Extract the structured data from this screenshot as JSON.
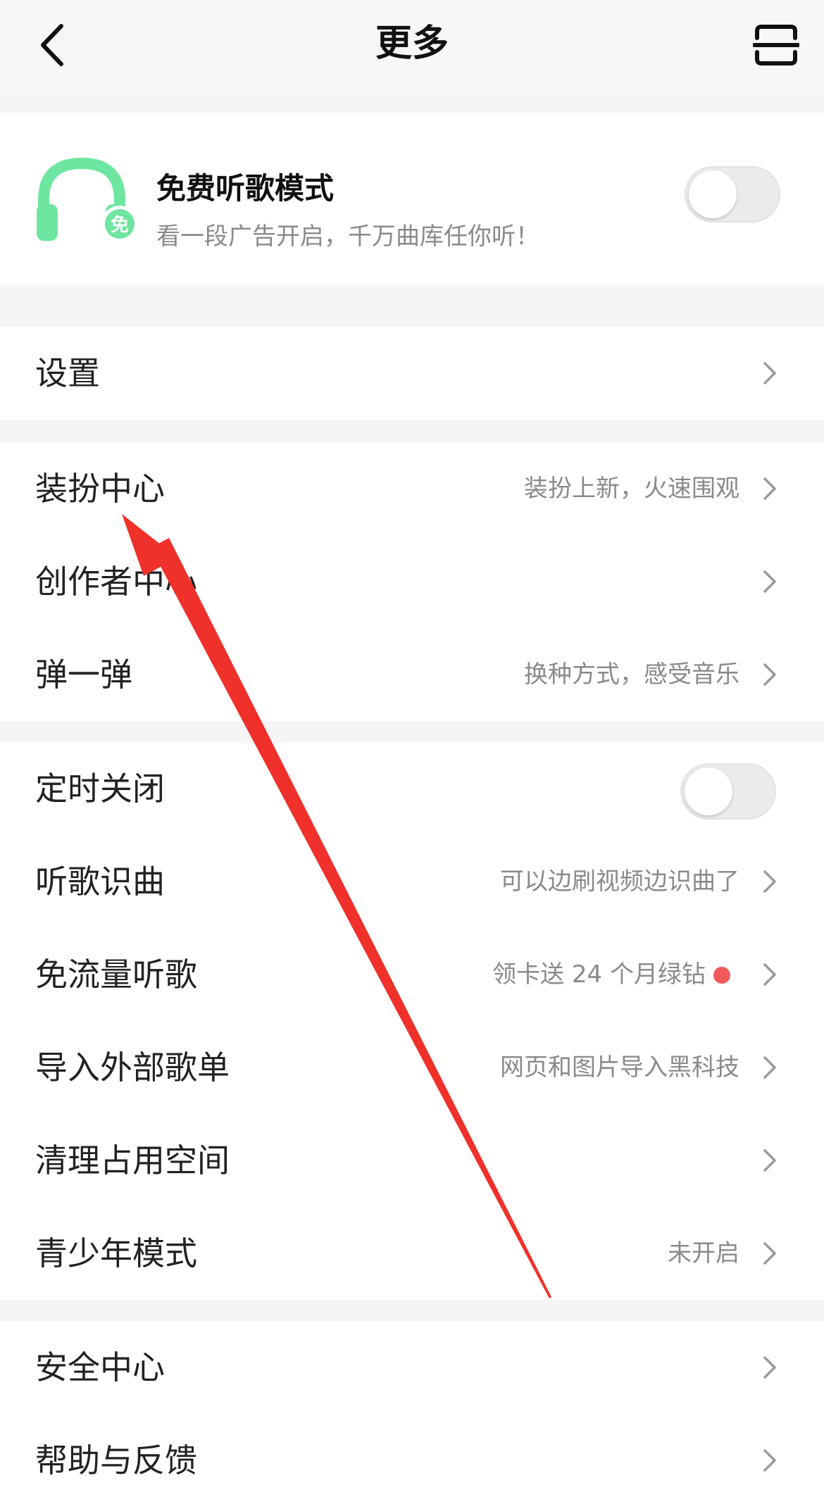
{
  "header": {
    "title": "更多",
    "back_icon": "chevron-left-icon",
    "scan_icon": "scan-icon"
  },
  "free_mode": {
    "title": "免费听歌模式",
    "subtitle": "看一段广告开启，千万曲库任你听！",
    "badge": "免",
    "accent_color": "#6ee6a0",
    "toggle_on": false
  },
  "group1": {
    "items": [
      {
        "label": "设置"
      }
    ]
  },
  "group2": {
    "items": [
      {
        "label": "装扮中心",
        "hint": "装扮上新，火速围观"
      },
      {
        "label": "创作者中心",
        "hint": ""
      },
      {
        "label": "弹一弹",
        "hint": "换种方式，感受音乐"
      }
    ]
  },
  "group3": {
    "items": [
      {
        "label": "定时关闭",
        "toggle_on": false
      },
      {
        "label": "听歌识曲",
        "hint": "可以边刷视频边识曲了"
      },
      {
        "label": "免流量听歌",
        "hint": "领卡送 24 个月绿钻",
        "dot_color": "#f05a5a"
      },
      {
        "label": "导入外部歌单",
        "hint": "网页和图片导入黑科技"
      },
      {
        "label": "清理占用空间",
        "hint": ""
      },
      {
        "label": "青少年模式",
        "hint": "未开启"
      }
    ]
  },
  "group4": {
    "items": [
      {
        "label": "安全中心"
      },
      {
        "label": "帮助与反馈"
      }
    ]
  },
  "annotation": {
    "arrow_color": "#f0302a"
  }
}
